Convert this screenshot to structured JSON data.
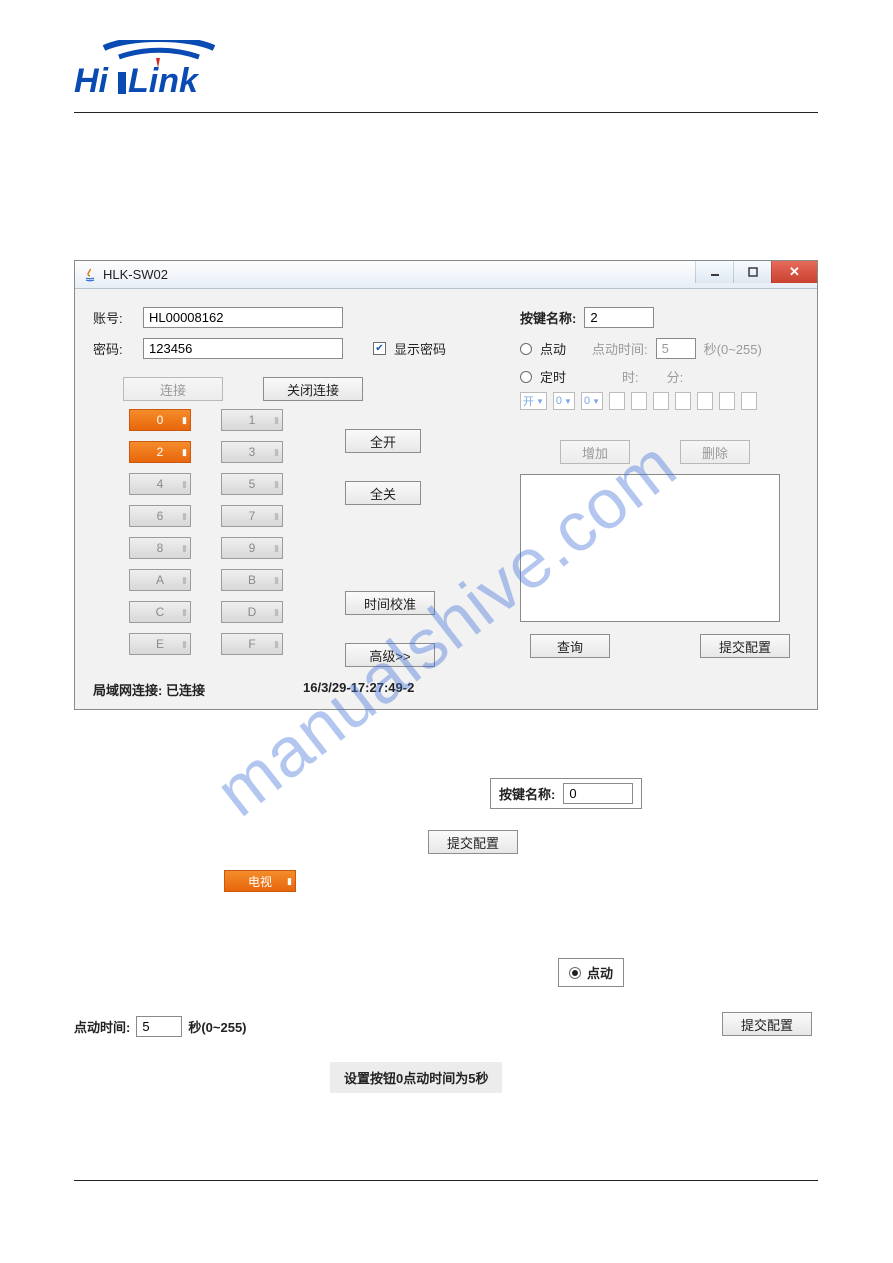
{
  "logo": {
    "brand_left": "Hi",
    "brand_right": "Link"
  },
  "win": {
    "title": "HLK-SW02",
    "account_label": "账号:",
    "account_value": "HL00008162",
    "password_label": "密码:",
    "password_value": "123456",
    "show_pwd_label": "显示密码",
    "show_pwd_checked": true,
    "connect_btn": "连接",
    "close_conn_btn": "关闭连接",
    "keys": [
      {
        "label": "0",
        "active": true
      },
      {
        "label": "1",
        "active": false
      },
      {
        "label": "2",
        "active": true
      },
      {
        "label": "3",
        "active": false
      },
      {
        "label": "4",
        "active": false
      },
      {
        "label": "5",
        "active": false
      },
      {
        "label": "6",
        "active": false
      },
      {
        "label": "7",
        "active": false
      },
      {
        "label": "8",
        "active": false
      },
      {
        "label": "9",
        "active": false
      },
      {
        "label": "A",
        "active": false
      },
      {
        "label": "B",
        "active": false
      },
      {
        "label": "C",
        "active": false
      },
      {
        "label": "D",
        "active": false
      },
      {
        "label": "E",
        "active": false
      },
      {
        "label": "F",
        "active": false
      }
    ],
    "all_on": "全开",
    "all_off": "全关",
    "time_calib": "时间校准",
    "advanced": "高级>>",
    "key_name_label": "按键名称:",
    "key_name_value": "2",
    "jog_label": "点动",
    "jog_time_label": "点动时间:",
    "jog_time_value": "5",
    "jog_time_unit": "秒(0~255)",
    "sched_label": "定时",
    "sched_hour": "时:",
    "sched_min": "分:",
    "sched_open": "开",
    "sched_zero": "0",
    "add_btn": "增加",
    "del_btn": "删除",
    "query_btn": "查询",
    "submit_btn": "提交配置",
    "status_label": "局域网连接:",
    "status_value": "已连接",
    "timestamp": "16/3/29-17:27:49-2"
  },
  "frag": {
    "key_name_label": "按键名称:",
    "key_name_value": "0",
    "submit_btn": "提交配置",
    "tv_btn": "电视",
    "jog_radio": "点动",
    "jog_time_label": "点动时间:",
    "jog_time_value": "5",
    "jog_time_unit": "秒(0~255)",
    "submit_btn2": "提交配置",
    "caption": "设置按钮0点动时间为5秒"
  },
  "watermark": "manualshive.com"
}
